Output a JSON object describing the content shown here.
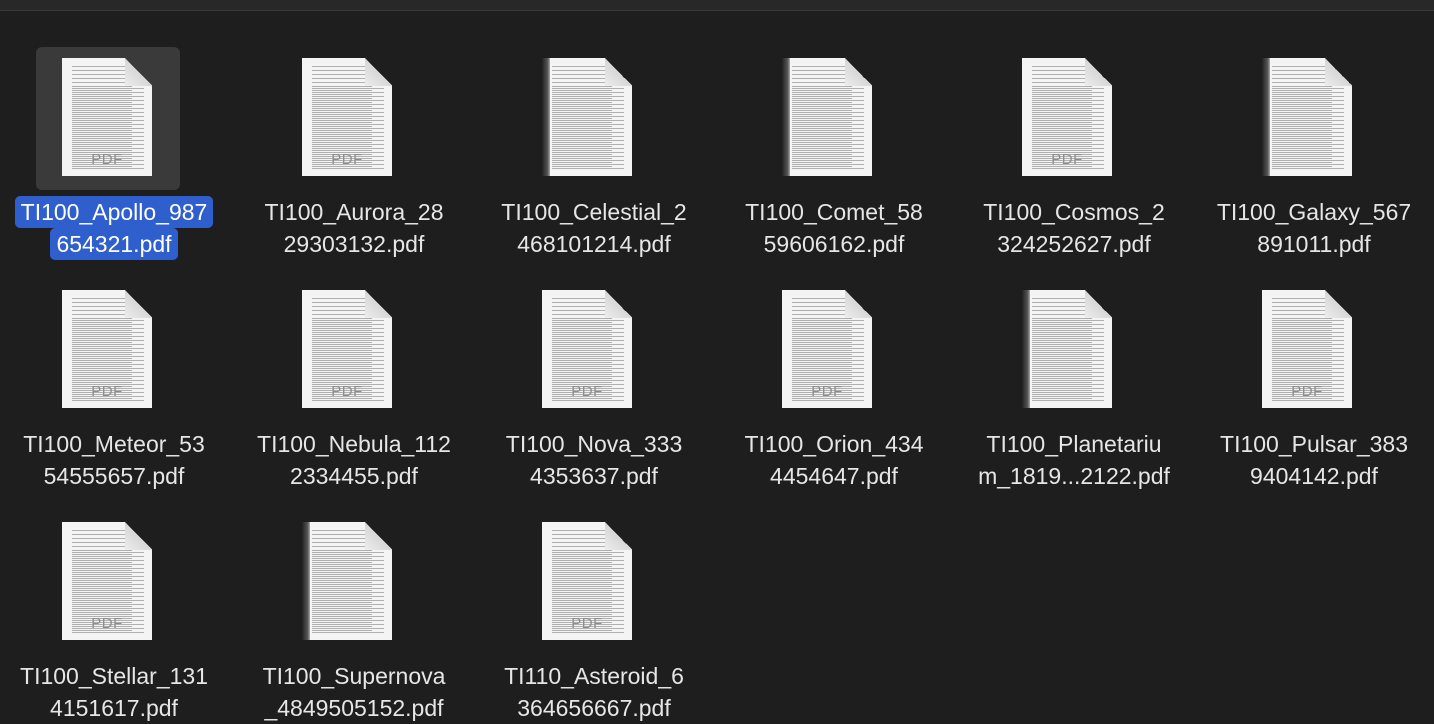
{
  "window": {
    "view": "icon-grid"
  },
  "files": [
    {
      "line1": "TI100_Apollo_987",
      "line2": "654321.pdf",
      "icon_label": "PDF",
      "selected": true,
      "dark_edge": false
    },
    {
      "line1": "TI100_Aurora_28",
      "line2": "29303132.pdf",
      "icon_label": "PDF",
      "selected": false,
      "dark_edge": false
    },
    {
      "line1": "TI100_Celestial_2",
      "line2": "468101214.pdf",
      "icon_label": "",
      "selected": false,
      "dark_edge": true
    },
    {
      "line1": "TI100_Comet_58",
      "line2": "59606162.pdf",
      "icon_label": "",
      "selected": false,
      "dark_edge": true
    },
    {
      "line1": "TI100_Cosmos_2",
      "line2": "324252627.pdf",
      "icon_label": "PDF",
      "selected": false,
      "dark_edge": false
    },
    {
      "line1": "TI100_Galaxy_567",
      "line2": "891011.pdf",
      "icon_label": "",
      "selected": false,
      "dark_edge": true
    },
    {
      "line1": "TI100_Meteor_53",
      "line2": "54555657.pdf",
      "icon_label": "PDF",
      "selected": false,
      "dark_edge": false
    },
    {
      "line1": "TI100_Nebula_112",
      "line2": "2334455.pdf",
      "icon_label": "PDF",
      "selected": false,
      "dark_edge": false
    },
    {
      "line1": "TI100_Nova_333",
      "line2": "4353637.pdf",
      "icon_label": "PDF",
      "selected": false,
      "dark_edge": false
    },
    {
      "line1": "TI100_Orion_434",
      "line2": "4454647.pdf",
      "icon_label": "PDF",
      "selected": false,
      "dark_edge": false
    },
    {
      "line1": "TI100_Planetariu",
      "line2": "m_1819...2122.pdf",
      "icon_label": "",
      "selected": false,
      "dark_edge": true
    },
    {
      "line1": "TI100_Pulsar_383",
      "line2": "9404142.pdf",
      "icon_label": "PDF",
      "selected": false,
      "dark_edge": false
    },
    {
      "line1": "TI100_Stellar_131",
      "line2": "4151617.pdf",
      "icon_label": "PDF",
      "selected": false,
      "dark_edge": false
    },
    {
      "line1": "TI100_Supernova",
      "line2": "_4849505152.pdf",
      "icon_label": "",
      "selected": false,
      "dark_edge": true
    },
    {
      "line1": "TI110_Asteroid_6",
      "line2": "364656667.pdf",
      "icon_label": "PDF",
      "selected": false,
      "dark_edge": false
    }
  ]
}
